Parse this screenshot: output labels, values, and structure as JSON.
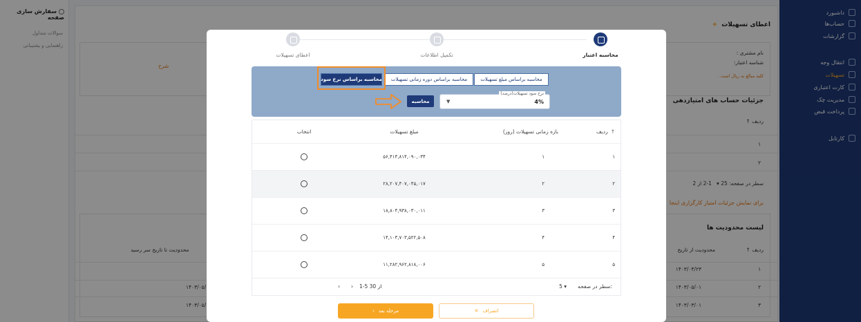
{
  "sidebar": {
    "items": [
      {
        "label": "داشبورد",
        "icon": "dashboard-icon"
      },
      {
        "label": "حساب‌ها",
        "icon": "accounts-icon"
      },
      {
        "label": "گزارشات",
        "icon": "reports-icon"
      },
      {
        "label": "انتقال وجه",
        "icon": "transfer-icon"
      },
      {
        "label": "تسهیلات",
        "icon": "loan-icon"
      },
      {
        "label": "کارت اعتباری",
        "icon": "card-icon"
      },
      {
        "label": "مدیریت چک",
        "icon": "check-icon"
      },
      {
        "label": "پرداخت قبض",
        "icon": "bill-icon"
      },
      {
        "label": "کارتابل",
        "icon": "cartable-icon"
      }
    ]
  },
  "left_panel": {
    "title": "سفارش سازی صفحه",
    "items": [
      "سوالات متداول",
      "راهنمایی و پشتیبانی"
    ]
  },
  "background": {
    "page_title": "اعطای تسهیلات",
    "customer_label": "نام مشتری :",
    "credit_id_label": "شناسه اعتبار:",
    "amounts_note": "کلیه مبالغ به ریال است .",
    "desc_header": "شرح",
    "score_title": "جزئیات حساب های امتیازدهی",
    "row_header": "ردیف",
    "rows_per_page_label": "سطر در صفحه:",
    "rows_per_page": "25",
    "range_text": "1-2 از 2",
    "hint": "برای نمایش جزئیات امتیاز کارگزاری اینجا",
    "limits_title": "لیست محدودیت ها",
    "limit_from_header": "محدودیت از تاریخ",
    "limit_to_header": "محدودیت تا تاریخ سر رسید",
    "dates_from": [
      "۱۴۰۳/۰۴/۲۳",
      "۱۴۰۳/۰۵/۰۱",
      "۱۴۰۳/۰۳/۰۱"
    ],
    "dates_to": [
      "-",
      "۱۴۰۳/۰۵/۱۷",
      "۱۴۰۳/۰۵/۱۰"
    ],
    "row_indices": [
      "۱",
      "۲",
      "۳"
    ]
  },
  "modal": {
    "steps": [
      {
        "label": "محاسبه اعتبار",
        "active": true
      },
      {
        "label": "تکمیل اطلاعات",
        "active": false
      },
      {
        "label": "اعطای تسهیلات",
        "active": false
      }
    ],
    "calc_modes": [
      "محاسبه براساس مبلغ تسهیلات",
      "محاسبه براساس دوره زمانی تسهیلات",
      "محاسبه براساس نرخ سود"
    ],
    "active_mode": "محاسبه براساس نرخ سود",
    "rate_label": "نرخ سود تسهیلات(درصد)",
    "rate_value": "4%",
    "calc_button": "محاسبه",
    "table": {
      "headers": {
        "index": "ردیف",
        "period": "بازه زمانی تسهیلات (روز)",
        "amount": "مبلغ تسهیلات",
        "select": "انتخاب"
      },
      "rows": [
        {
          "index": "۱",
          "period": "۱",
          "amount": "۵۶,۴۱۴,۸۱۴,۰۹۰,۰۳۴"
        },
        {
          "index": "۲",
          "period": "۲",
          "amount": "۲۸,۲۰۷,۴۰۷,۰۴۵,۰۱۷"
        },
        {
          "index": "۳",
          "period": "۳",
          "amount": "۱۸,۸۰۴,۹۳۸,۰۳۰,۰۱۱"
        },
        {
          "index": "۴",
          "period": "۴",
          "amount": "۱۴,۱۰۳,۷۰۳,۵۲۲,۵۰۸"
        },
        {
          "index": "۵",
          "period": "۵",
          "amount": "۱۱,۲۸۲,۹۶۲,۸۱۸,۰۰۶"
        }
      ]
    },
    "pager": {
      "label": "سطر در صفحه:",
      "per_page": "5",
      "range": "1-5 از 30"
    },
    "next_button": "مرحله بعد",
    "cancel_button": "انصراف"
  }
}
